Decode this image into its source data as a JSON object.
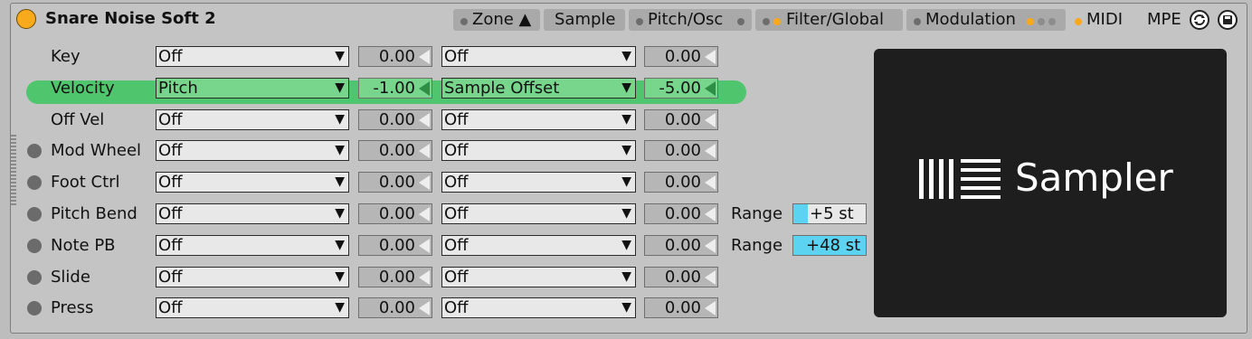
{
  "device": {
    "title": "Snare Noise Soft 2",
    "mpe_label": "MPE"
  },
  "tabs": [
    {
      "label": "Zone ▲"
    },
    {
      "label": "Sample"
    },
    {
      "label": "Pitch/Osc"
    },
    {
      "label": "Filter/Global"
    },
    {
      "label": "Modulation"
    },
    {
      "label": "MIDI"
    }
  ],
  "rows": [
    {
      "label": "Key",
      "dest1": "Off",
      "amt1": "0.00",
      "dest2": "Off",
      "amt2": "0.00"
    },
    {
      "label": "Velocity",
      "dest1": "Pitch",
      "amt1": "-1.00",
      "dest2": "Sample Offset",
      "amt2": "-5.00"
    },
    {
      "label": "Off Vel",
      "dest1": "Off",
      "amt1": "0.00",
      "dest2": "Off",
      "amt2": "0.00"
    },
    {
      "label": "Mod Wheel",
      "dest1": "Off",
      "amt1": "0.00",
      "dest2": "Off",
      "amt2": "0.00"
    },
    {
      "label": "Foot Ctrl",
      "dest1": "Off",
      "amt1": "0.00",
      "dest2": "Off",
      "amt2": "0.00"
    },
    {
      "label": "Pitch Bend",
      "dest1": "Off",
      "amt1": "0.00",
      "dest2": "Off",
      "amt2": "0.00",
      "range_label": "Range",
      "range_value": "+5 st",
      "range_fraction": 0.2
    },
    {
      "label": "Note PB",
      "dest1": "Off",
      "amt1": "0.00",
      "dest2": "Off",
      "amt2": "0.00",
      "range_label": "Range",
      "range_value": "+48 st",
      "range_fraction": 1.0
    },
    {
      "label": "Slide",
      "dest1": "Off",
      "amt1": "0.00",
      "dest2": "Off",
      "amt2": "0.00"
    },
    {
      "label": "Press",
      "dest1": "Off",
      "amt1": "0.00",
      "dest2": "Off",
      "amt2": "0.00"
    }
  ],
  "logo": {
    "text": "Sampler"
  },
  "colors": {
    "accent_orange": "#f9a91c",
    "highlight_green": "#4fc56d",
    "range_cyan": "#5bd3f1"
  },
  "icons": {
    "dropdown": "triangle-down-icon",
    "amount": "triangle-left-icon",
    "mpe_toggle": "mpe-cycle-icon",
    "save": "save-icon"
  }
}
